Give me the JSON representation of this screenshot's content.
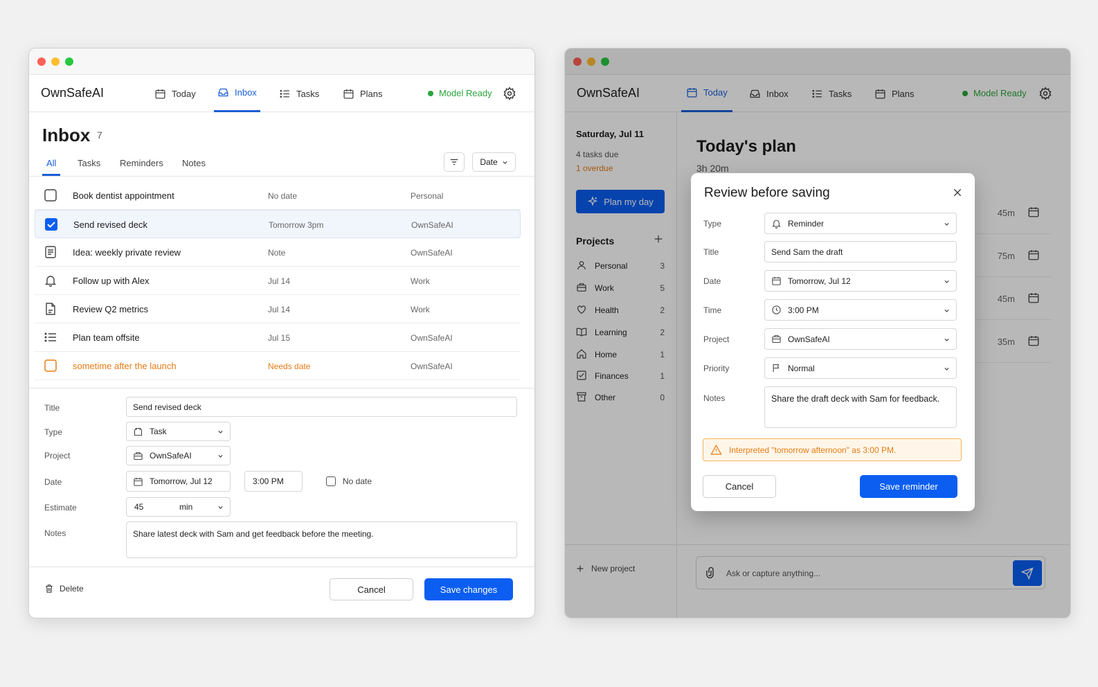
{
  "left": {
    "brand": "OwnSafeAI",
    "nav": [
      {
        "label": "Today",
        "icon": "calendar-icon"
      },
      {
        "label": "Inbox",
        "icon": "inbox-icon"
      },
      {
        "label": "Tasks",
        "icon": "list-icon"
      },
      {
        "label": "Plans",
        "icon": "calendar-icon"
      }
    ],
    "model_status": "Model Ready",
    "heading": "Inbox",
    "count": "7",
    "tabs": [
      "All",
      "Tasks",
      "Reminders",
      "Notes"
    ],
    "sort_label": "Date",
    "rows": [
      {
        "title": "Book dentist appointment",
        "date": "No date",
        "project": "Personal",
        "icon": "checkbox-icon"
      },
      {
        "title": "Send revised deck",
        "date": "Tomorrow 3pm",
        "project": "OwnSafeAI",
        "icon": "checkbox-checked-icon"
      },
      {
        "title": "Idea: weekly private review",
        "date": "Note",
        "project": "OwnSafeAI",
        "icon": "note-icon"
      },
      {
        "title": "Follow up with Alex",
        "date": "Jul 14",
        "project": "Work",
        "icon": "bell-icon"
      },
      {
        "title": "Review Q2 metrics",
        "date": "Jul 14",
        "project": "Work",
        "icon": "document-icon"
      },
      {
        "title": "Plan team offsite",
        "date": "Jul 15",
        "project": "OwnSafeAI",
        "icon": "list-icon"
      },
      {
        "title": "sometime after the launch",
        "date": "Needs date",
        "project": "OwnSafeAI",
        "icon": "checkbox-warning-icon"
      }
    ],
    "editor": {
      "title_label": "Title",
      "title_value": "Send revised deck",
      "type_label": "Type",
      "type_value": "Task",
      "project_label": "Project",
      "project_value": "OwnSafeAI",
      "date_label": "Date",
      "date_value": "Tomorrow, Jul 12",
      "time_value": "3:00 PM",
      "no_date_label": "No date",
      "estimate_label": "Estimate",
      "estimate_value": "45",
      "estimate_unit": "min",
      "notes_label": "Notes",
      "notes_value": "Share latest deck with Sam and get feedback before the meeting."
    },
    "footer": {
      "delete": "Delete",
      "cancel": "Cancel",
      "save": "Save changes"
    }
  },
  "right": {
    "brand": "OwnSafeAI",
    "nav": [
      {
        "label": "Today",
        "icon": "calendar-icon"
      },
      {
        "label": "Inbox",
        "icon": "inbox-icon"
      },
      {
        "label": "Tasks",
        "icon": "list-icon"
      },
      {
        "label": "Plans",
        "icon": "calendar-icon"
      }
    ],
    "model_status": "Model Ready",
    "sidebar": {
      "date": "Saturday, Jul 11",
      "due": "4 tasks due",
      "overdue": "1 overdue",
      "plan_button": "Plan my day",
      "projects_heading": "Projects",
      "projects": [
        {
          "name": "Personal",
          "count": "3",
          "icon": "person-icon"
        },
        {
          "name": "Work",
          "count": "5",
          "icon": "briefcase-icon"
        },
        {
          "name": "Health",
          "count": "2",
          "icon": "heart-icon"
        },
        {
          "name": "Learning",
          "count": "2",
          "icon": "book-icon"
        },
        {
          "name": "Home",
          "count": "1",
          "icon": "home-icon"
        },
        {
          "name": "Finances",
          "count": "1",
          "icon": "check-square-icon"
        },
        {
          "name": "Other",
          "count": "0",
          "icon": "archive-icon"
        }
      ],
      "new_project": "New project"
    },
    "main": {
      "heading": "Today's plan",
      "subheading": "3h 20m",
      "durations": [
        "45m",
        "75m",
        "45m",
        "35m"
      ],
      "composer_placeholder": "Ask or capture anything..."
    },
    "modal": {
      "title": "Review before saving",
      "type_label": "Type",
      "type_value": "Reminder",
      "title_label": "Title",
      "title_value": "Send Sam the draft",
      "date_label": "Date",
      "date_value": "Tomorrow, Jul 12",
      "time_label": "Time",
      "time_value": "3:00 PM",
      "project_label": "Project",
      "project_value": "OwnSafeAI",
      "priority_label": "Priority",
      "priority_value": "Normal",
      "notes_label": "Notes",
      "notes_value": "Share the draft deck with Sam for feedback.",
      "warning": "Interpreted \"tomorrow afternoon\" as 3:00 PM.",
      "cancel": "Cancel",
      "save": "Save reminder"
    }
  },
  "colors": {
    "accent": "#0b5ef0",
    "ready": "#2aa43b",
    "warning": "#e77b13"
  }
}
